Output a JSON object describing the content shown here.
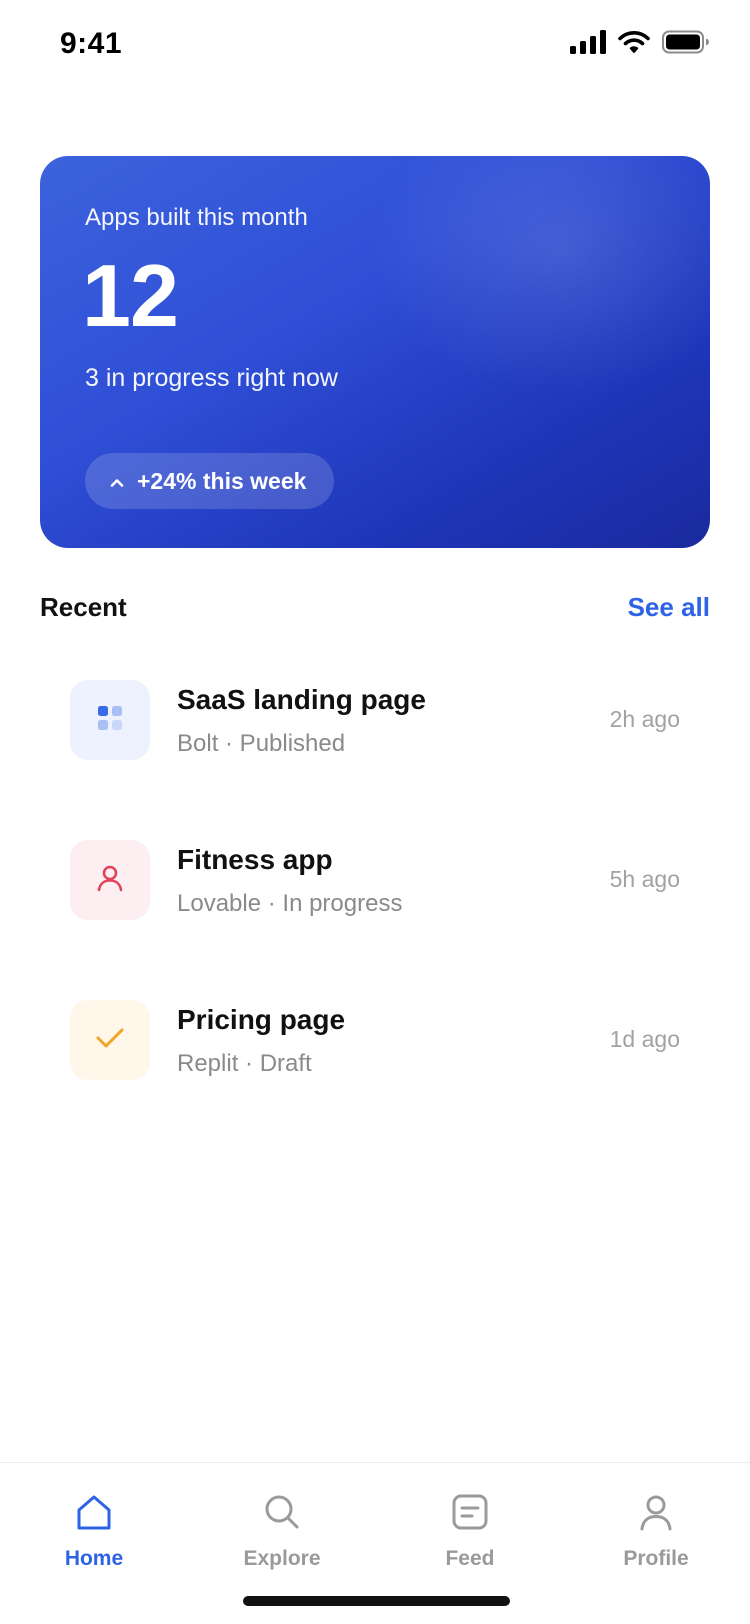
{
  "status_bar": {
    "time": "9:41"
  },
  "hero": {
    "label": "Apps built this month",
    "count": "12",
    "subtitle": "3 in progress right now",
    "badge": "+24% this week"
  },
  "recent": {
    "title": "Recent",
    "see_all": "See all",
    "items": [
      {
        "title": "SaaS landing page",
        "meta": "Bolt · Published",
        "time": "2h ago",
        "icon": "grid-icon",
        "icon_color": "#3a6be8",
        "icon_bg": "#edf2fe"
      },
      {
        "title": "Fitness app",
        "meta": "Lovable · In progress",
        "time": "5h ago",
        "icon": "user-icon",
        "icon_color": "#e2425a",
        "icon_bg": "#fdeef1"
      },
      {
        "title": "Pricing page",
        "meta": "Replit · Draft",
        "time": "1d ago",
        "icon": "check-icon",
        "icon_color": "#f0a526",
        "icon_bg": "#fef7ea"
      }
    ]
  },
  "tabs": [
    {
      "label": "Home",
      "icon": "home-icon",
      "active": true
    },
    {
      "label": "Explore",
      "icon": "search-icon",
      "active": false
    },
    {
      "label": "Feed",
      "icon": "feed-icon",
      "active": false
    },
    {
      "label": "Profile",
      "icon": "profile-icon",
      "active": false
    }
  ],
  "colors": {
    "accent": "#2e63e6",
    "hero_gradient_start": "#3c62dd",
    "hero_gradient_end": "#1a2a9e",
    "muted_text": "#8a8a8a"
  }
}
